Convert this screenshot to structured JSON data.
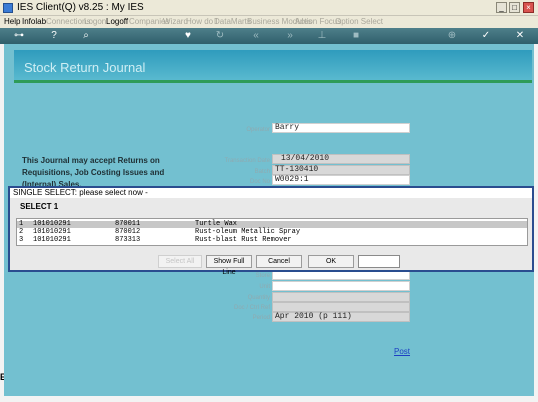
{
  "window": {
    "title": "IES Client(Q) v8.25 : My IES"
  },
  "menu": {
    "items": [
      "Help",
      "Infolab",
      "Connections",
      "Logon",
      "Logoff",
      "Companies",
      "Wizard",
      "How do I",
      "DataMarts",
      "Business Modules",
      "Action Focus",
      "Option Select"
    ]
  },
  "page": {
    "title": "Stock Return Journal"
  },
  "info": {
    "text": "This Journal may accept Returns on Requisitions, Job Costing Issues and (Internal) Sales."
  },
  "fields": {
    "operator": {
      "label": "Operator",
      "value": "Barry"
    },
    "transaction_date": {
      "label": "Transaction Date",
      "value": "13/04/2010"
    },
    "batch": {
      "label": "Batch",
      "value": "TT-130410"
    },
    "doc_no": {
      "label": "Doc No",
      "value": "W0029:1"
    },
    "store": {
      "label": "Store",
      "value": ""
    },
    "unit": {
      "label": "Unit",
      "value": ""
    },
    "quantity": {
      "label": "Quantity",
      "value": ""
    },
    "doc_ctrl_ref": {
      "label": "Doc / Ctrl Ref",
      "value": ""
    },
    "period": {
      "label": "Period",
      "value": "Apr 2010 (p 111)"
    }
  },
  "post_link": "Post",
  "dialog": {
    "title": "SINGLE SELECT: please select now -",
    "subtitle": "SELECT  1",
    "rows": [
      {
        "num": "1",
        "code": "101010291",
        "item": "870011",
        "desc": "Turtle Wax",
        "selected": true
      },
      {
        "num": "2",
        "code": "101010291",
        "item": "870012",
        "desc": "Rust-oleum Metallic Spray",
        "selected": false
      },
      {
        "num": "3",
        "code": "101010291",
        "item": "873313",
        "desc": "Rust-blast Rust Remover",
        "selected": false
      }
    ],
    "buttons": {
      "select_all": "Select All",
      "show_full_line": "Show Full Line",
      "cancel": "Cancel",
      "ok": "OK"
    }
  },
  "toolbar_icons": [
    "key-icon",
    "help-icon",
    "search-icon",
    "heart-icon",
    "refresh-icon",
    "rewind-icon",
    "fast-forward-icon",
    "pin-icon",
    "stop-icon",
    "add-icon",
    "check-icon",
    "close-icon"
  ],
  "colors": {
    "background": "#73c0d0",
    "banner": "#2f9bbd",
    "accent_green": "#2e9b58",
    "dialog_border": "#2a4d8f"
  }
}
